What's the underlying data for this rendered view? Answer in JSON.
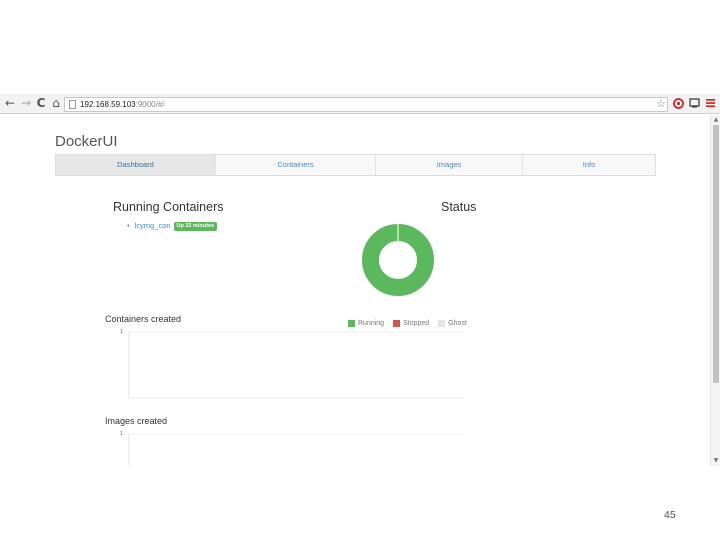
{
  "browser": {
    "url_host": "192.168.59.103",
    "url_rest": ":9000/#/",
    "nav": {
      "back": "←",
      "forward": "→",
      "reload": "C",
      "home": "⌂"
    }
  },
  "app": {
    "brand": "DockerUI",
    "tabs": [
      {
        "label": "Dashboard",
        "active": true
      },
      {
        "label": "Containers",
        "active": false
      },
      {
        "label": "Images",
        "active": false
      },
      {
        "label": "Info",
        "active": false
      }
    ]
  },
  "running": {
    "title": "Running Containers",
    "containers": [
      {
        "name": "lcymg_con",
        "status": "Up 22 minutes"
      }
    ]
  },
  "status": {
    "title": "Status",
    "colors": {
      "running": "#5cb85c",
      "stopped": "#c9574c",
      "ghost": "#e5e5e5"
    },
    "legend": [
      "Running",
      "Stopped",
      "Ghost"
    ]
  },
  "chart_data": [
    {
      "type": "pie",
      "title": "Status",
      "categories": [
        "Running",
        "Stopped",
        "Ghost"
      ],
      "values": [
        1,
        0,
        0
      ]
    },
    {
      "type": "line",
      "title": "Containers created",
      "y_ticks": [
        "1"
      ],
      "series": []
    },
    {
      "type": "line",
      "title": "Images created",
      "y_ticks": [
        "1"
      ],
      "series": []
    }
  ],
  "plots": {
    "containers_title": "Containers created",
    "containers_tick": "1",
    "images_title": "Images created",
    "images_tick": "1"
  },
  "slide": {
    "number": "45"
  }
}
